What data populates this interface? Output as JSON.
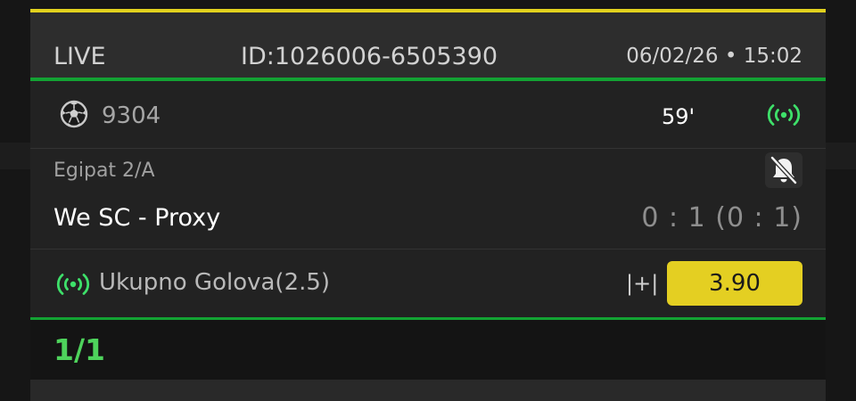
{
  "colors": {
    "accent_yellow": "#e2d11e",
    "accent_green": "#13a233",
    "live_green": "#3ee06a",
    "counter_green": "#4ed35c",
    "odds_button_bg": "#e4cf22"
  },
  "header": {
    "live_label": "LIVE",
    "event_id": "ID:1026006-6505390",
    "datetime": "06/02/26 • 15:02"
  },
  "event": {
    "sport_icon": "soccer-ball-icon",
    "code": "9304",
    "minute": "59'",
    "live_icon": "live-broadcast-icon"
  },
  "match": {
    "league": "Egipat 2/A",
    "teams": "We SC - Proxy",
    "score": "0 : 1 (0 : 1)",
    "mute_icon": "bell-off-icon"
  },
  "market": {
    "live_icon": "live-broadcast-icon",
    "name": "Ukupno Golova(2.5)",
    "odds_type": "|+|",
    "odds": "3.90"
  },
  "footer": {
    "counter": "1/1"
  }
}
